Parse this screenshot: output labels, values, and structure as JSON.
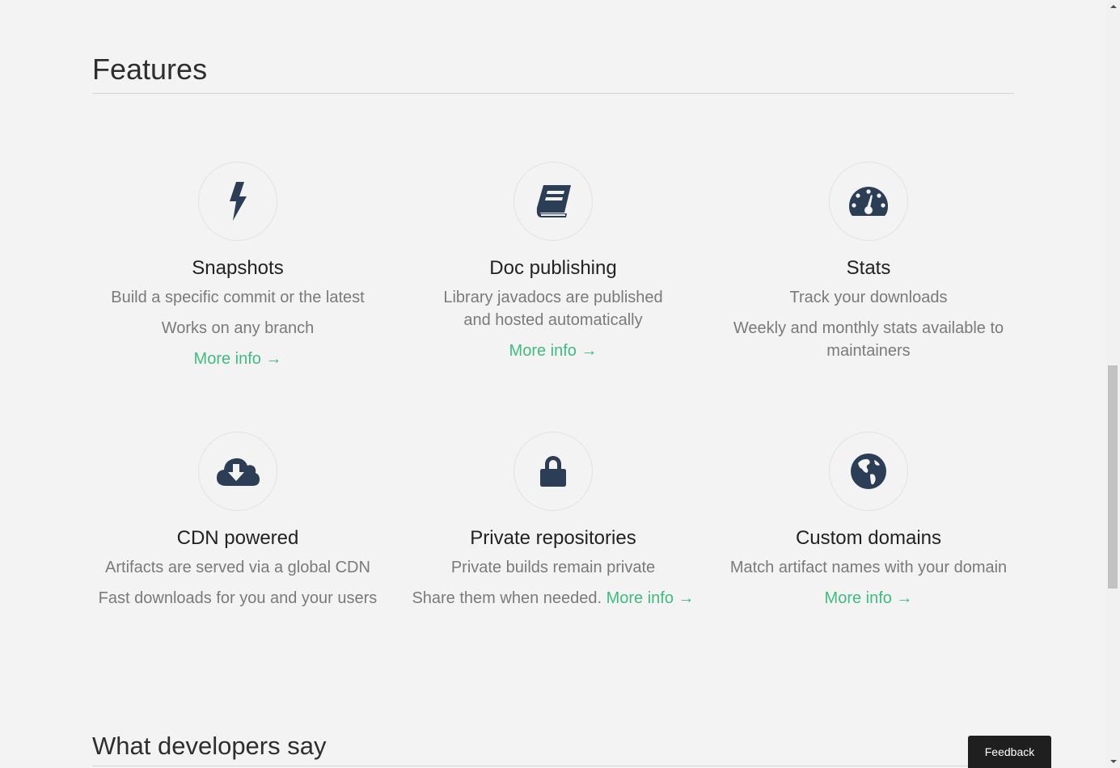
{
  "sections": {
    "features_title": "Features",
    "developers_title": "What developers say"
  },
  "features": [
    {
      "title": "Snapshots",
      "lines": [
        "Build a specific commit or the latest",
        "Works on any branch"
      ],
      "link": "More info →",
      "icon": "bolt-icon"
    },
    {
      "title": "Doc publishing",
      "lines": [
        "Library javadocs are published and hosted automatically"
      ],
      "link": "More info →",
      "icon": "book-icon"
    },
    {
      "title": "Stats",
      "lines": [
        "Track your downloads",
        "Weekly and monthly stats available to maintainers"
      ],
      "icon": "dashboard-icon"
    },
    {
      "title": "CDN powered",
      "lines": [
        "Artifacts are served via a global CDN",
        "Fast downloads for you and your users"
      ],
      "icon": "cloud-download-icon"
    },
    {
      "title": "Private repositories",
      "lines": [
        "Private builds remain private",
        "Share them when needed."
      ],
      "link": "More info →",
      "icon": "lock-icon"
    },
    {
      "title": "Custom domains",
      "lines": [
        "Match artifact names with your domain"
      ],
      "link": "More info →",
      "icon": "globe-icon"
    }
  ],
  "feedback_label": "Feedback",
  "colors": {
    "background": "#f3f3f3",
    "icon": "#2c3e55",
    "link": "#3fbc7f",
    "body_text": "#7a7a7a",
    "feedback_bg": "#1f1f1f"
  }
}
